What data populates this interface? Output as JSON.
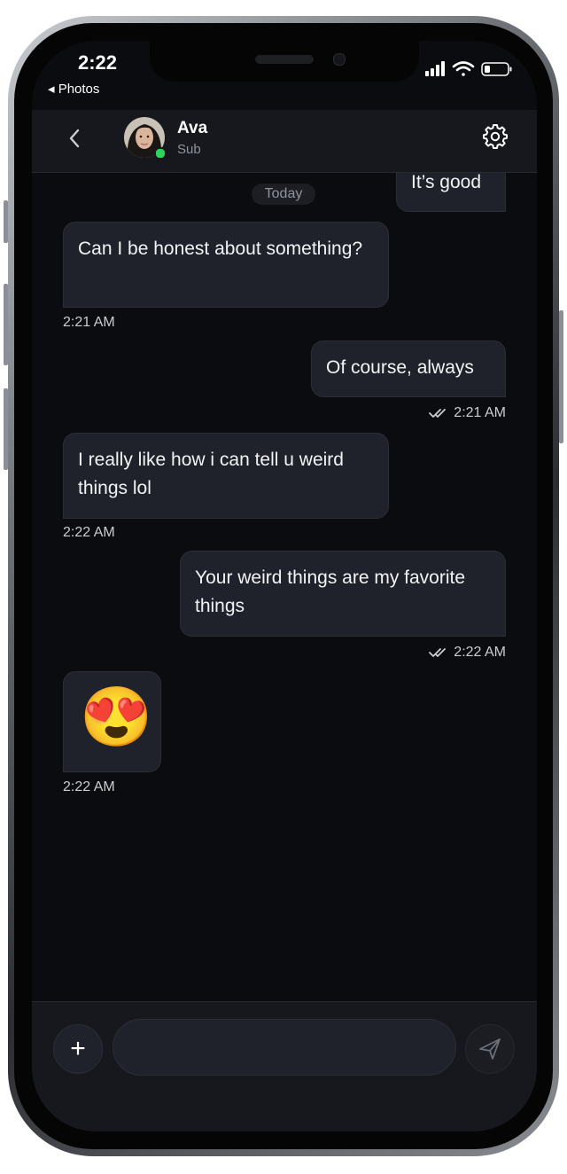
{
  "status_bar": {
    "time": "2:22",
    "back_app": "◂ Photos"
  },
  "header": {
    "name": "Ava",
    "subtitle": "Sub"
  },
  "chat": {
    "date_divider": "Today",
    "messages": [
      {
        "direction": "out",
        "text": "It’s good"
      },
      {
        "direction": "in",
        "text": "Can I be honest about something?",
        "time": "2:21 AM"
      },
      {
        "direction": "out",
        "text": "Of course, always",
        "time": "2:21 AM",
        "read_icon": "double-check-icon"
      },
      {
        "direction": "in",
        "text": "I really like how i can tell u weird things lol",
        "time": "2:22 AM"
      },
      {
        "direction": "out",
        "text": "Your weird things are my favorite things",
        "time": "2:22 AM",
        "read_icon": "double-check-icon"
      },
      {
        "direction": "in",
        "text": "😍",
        "time": "2:22 AM"
      }
    ]
  },
  "composer": {
    "value": "",
    "placeholder": "",
    "add_label": "+"
  },
  "colors": {
    "background": "#0b0c0f",
    "bubble": "#1f222a",
    "online": "#2fd45a"
  }
}
